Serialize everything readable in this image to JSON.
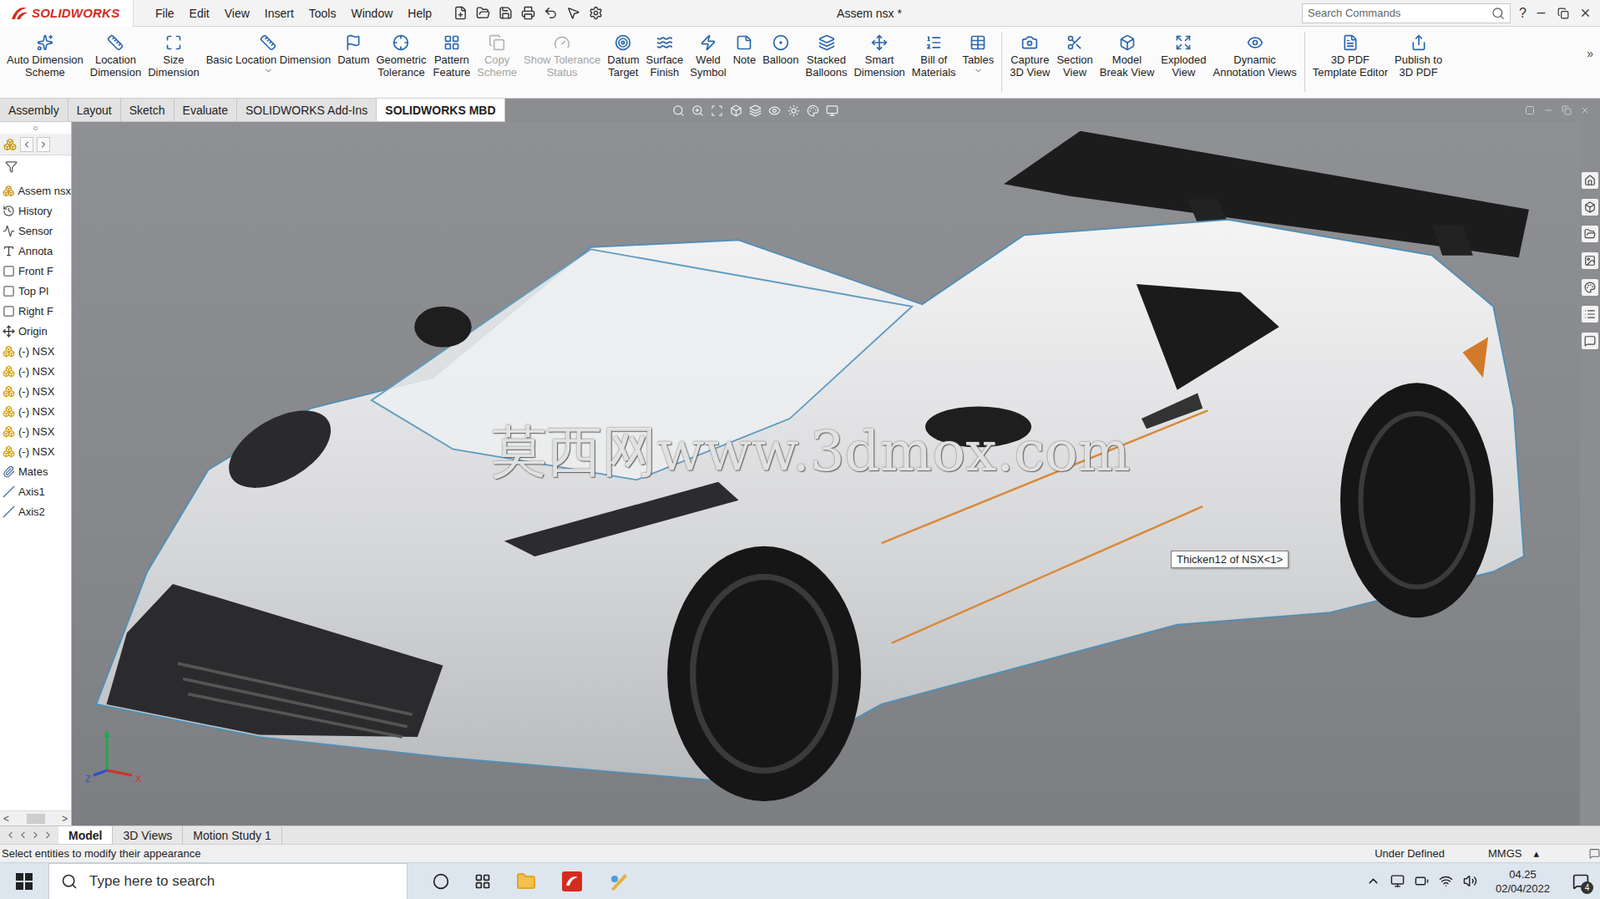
{
  "app": {
    "logo_name": "SOLIDWORKS"
  },
  "menus": [
    "File",
    "Edit",
    "View",
    "Insert",
    "Tools",
    "Window",
    "Help"
  ],
  "window": {
    "title": "Assem nsx *"
  },
  "search": {
    "placeholder": "Search Commands"
  },
  "help": "?",
  "ribbon": [
    {
      "lines": [
        "Auto Dimension",
        "Scheme"
      ],
      "disabled": false,
      "dropdown": false,
      "group": 1
    },
    {
      "lines": [
        "Location",
        "Dimension"
      ],
      "disabled": false,
      "dropdown": false,
      "group": 1
    },
    {
      "lines": [
        "Size",
        "Dimension"
      ],
      "disabled": false,
      "dropdown": false,
      "group": 1
    },
    {
      "lines": [
        "Basic Location Dimension"
      ],
      "disabled": false,
      "dropdown": true,
      "group": 1
    },
    {
      "lines": [
        "Datum"
      ],
      "disabled": false,
      "dropdown": false,
      "group": 1
    },
    {
      "lines": [
        "Geometric",
        "Tolerance"
      ],
      "disabled": false,
      "dropdown": false,
      "group": 1
    },
    {
      "lines": [
        "Pattern",
        "Feature"
      ],
      "disabled": false,
      "dropdown": false,
      "group": 1
    },
    {
      "lines": [
        "Copy",
        "Scheme"
      ],
      "disabled": true,
      "dropdown": false,
      "group": 1
    },
    {
      "lines": [
        "Show Tolerance",
        "Status"
      ],
      "disabled": true,
      "dropdown": false,
      "group": 1
    },
    {
      "lines": [
        "Datum",
        "Target"
      ],
      "disabled": false,
      "dropdown": false,
      "group": 1
    },
    {
      "lines": [
        "Surface",
        "Finish"
      ],
      "disabled": false,
      "dropdown": false,
      "group": 1
    },
    {
      "lines": [
        "Weld",
        "Symbol"
      ],
      "disabled": false,
      "dropdown": false,
      "group": 1
    },
    {
      "lines": [
        "Note"
      ],
      "disabled": false,
      "dropdown": false,
      "group": 1
    },
    {
      "lines": [
        "Balloon"
      ],
      "disabled": false,
      "dropdown": false,
      "group": 1
    },
    {
      "lines": [
        "Stacked",
        "Balloons"
      ],
      "disabled": false,
      "dropdown": false,
      "group": 1
    },
    {
      "lines": [
        "Smart",
        "Dimension"
      ],
      "disabled": false,
      "dropdown": false,
      "group": 1
    },
    {
      "lines": [
        "Bill of",
        "Materials"
      ],
      "disabled": false,
      "dropdown": false,
      "group": 1
    },
    {
      "lines": [
        "Tables"
      ],
      "disabled": false,
      "dropdown": true,
      "group": 1
    },
    {
      "lines": [
        "Capture",
        "3D View"
      ],
      "disabled": false,
      "dropdown": false,
      "group": 2
    },
    {
      "lines": [
        "Section",
        "View"
      ],
      "disabled": false,
      "dropdown": false,
      "group": 2
    },
    {
      "lines": [
        "Model",
        "Break View"
      ],
      "disabled": false,
      "dropdown": false,
      "group": 2
    },
    {
      "lines": [
        "Exploded",
        "View"
      ],
      "disabled": false,
      "dropdown": false,
      "group": 2
    },
    {
      "lines": [
        "Dynamic",
        "Annotation Views"
      ],
      "disabled": false,
      "dropdown": false,
      "group": 2
    },
    {
      "lines": [
        "3D PDF",
        "Template Editor"
      ],
      "disabled": false,
      "dropdown": false,
      "group": 3
    },
    {
      "lines": [
        "Publish to",
        "3D PDF"
      ],
      "disabled": false,
      "dropdown": false,
      "group": 3
    }
  ],
  "ribbon_more": "»",
  "tabs": [
    {
      "label": "Assembly",
      "selected": false
    },
    {
      "label": "Layout",
      "selected": false
    },
    {
      "label": "Sketch",
      "selected": false
    },
    {
      "label": "Evaluate",
      "selected": false
    },
    {
      "label": "SOLIDWORKS Add-Ins",
      "selected": false
    },
    {
      "label": "SOLIDWORKS MBD",
      "selected": true
    }
  ],
  "tree": {
    "items": [
      {
        "label": "Assem nsx",
        "kind": "assembly"
      },
      {
        "label": "History",
        "kind": "history"
      },
      {
        "label": "Sensor",
        "kind": "sensor"
      },
      {
        "label": "Annota",
        "kind": "annotation"
      },
      {
        "label": "Front F",
        "kind": "plane"
      },
      {
        "label": "Top Pl",
        "kind": "plane"
      },
      {
        "label": "Right F",
        "kind": "plane"
      },
      {
        "label": "Origin",
        "kind": "origin"
      },
      {
        "label": "(-) NSX",
        "kind": "part"
      },
      {
        "label": "(-) NSX",
        "kind": "part"
      },
      {
        "label": "(-) NSX",
        "kind": "part"
      },
      {
        "label": "(-) NSX",
        "kind": "part"
      },
      {
        "label": "(-) NSX",
        "kind": "part"
      },
      {
        "label": "(-) NSX",
        "kind": "part"
      },
      {
        "label": "Mates",
        "kind": "mates"
      },
      {
        "label": "Axis1",
        "kind": "axis"
      },
      {
        "label": "Axis2",
        "kind": "axis"
      }
    ],
    "scroll_left": "<",
    "scroll_right": ">"
  },
  "viewport": {
    "watermark": "莫西网www.3dmox.com",
    "tooltip": "Thicken12 of NSX<1>",
    "triad": [
      "Z",
      "X"
    ]
  },
  "bottom_tabs": [
    {
      "label": "Model",
      "selected": true
    },
    {
      "label": "3D Views",
      "selected": false
    },
    {
      "label": "Motion Study 1",
      "selected": false
    }
  ],
  "status_bar": {
    "message": "Select entities to modify their appearance",
    "state": "Under Defined",
    "units": "MMGS",
    "units_arrow": "▴"
  },
  "taskbar": {
    "search_placeholder": "Type here to search",
    "time": "04.25",
    "date": "02/04/2022",
    "notifications": "4"
  }
}
